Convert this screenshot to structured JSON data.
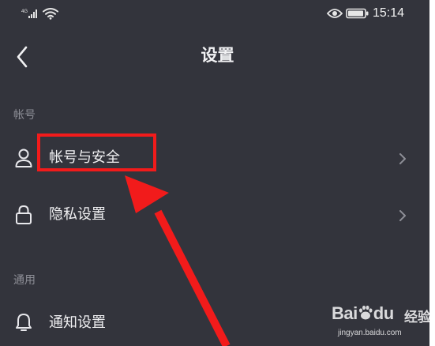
{
  "status_bar": {
    "signal_label": "4G",
    "time": "15:14"
  },
  "header": {
    "back_icon": "chevron-left-icon",
    "title": "设置"
  },
  "sections": [
    {
      "header": "帐号",
      "items": [
        {
          "label": "帐号与安全",
          "icon": "user-icon"
        },
        {
          "label": "隐私设置",
          "icon": "lock-icon"
        }
      ]
    },
    {
      "header": "通用",
      "items": [
        {
          "label": "通知设置",
          "icon": "bell-icon"
        }
      ]
    }
  ],
  "colors": {
    "background": "#33343c",
    "text": "#f0f0f2",
    "section_header": "#8e8f97",
    "annotation_red": "#f21b1b"
  },
  "watermark": {
    "brand_left": "Bai",
    "brand_right": "du",
    "brand_suffix": "经验",
    "url": "jingyan.baidu.com"
  }
}
